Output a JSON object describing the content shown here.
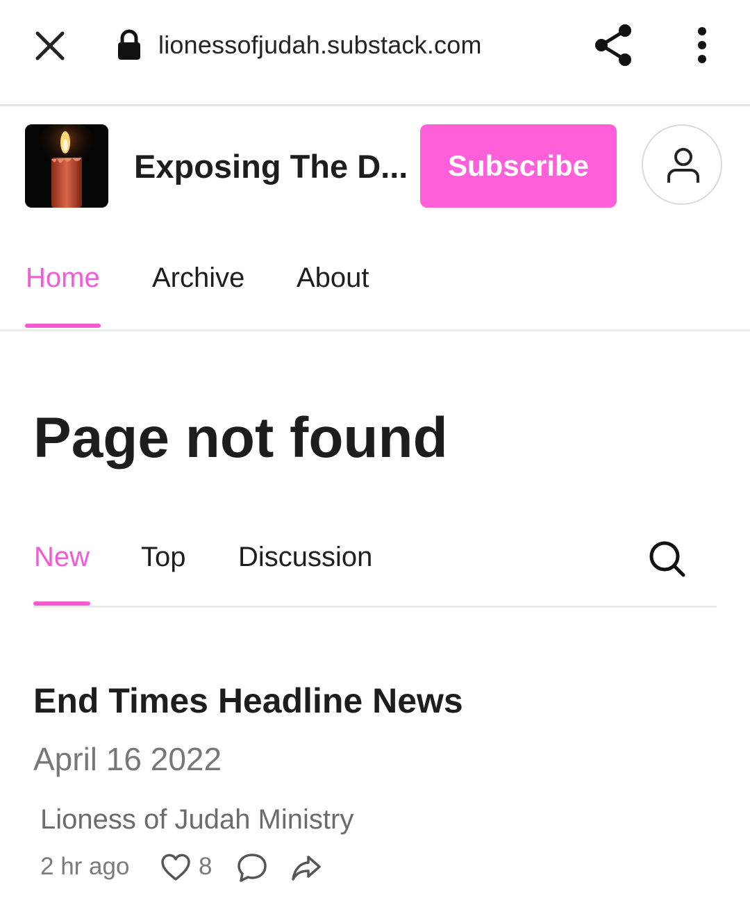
{
  "browser": {
    "url": "lionessofjudah.substack.com",
    "close_icon": "close-icon",
    "lock_icon": "lock-icon",
    "share_icon": "share-icon",
    "menu_icon": "more-vertical-icon"
  },
  "publication": {
    "name": "Exposing The D...",
    "logo": "candle-logo",
    "subscribe_label": "Subscribe",
    "profile_icon": "user-icon"
  },
  "nav": {
    "tabs": [
      {
        "label": "Home",
        "active": true
      },
      {
        "label": "Archive",
        "active": false
      },
      {
        "label": "About",
        "active": false
      }
    ]
  },
  "page": {
    "title": "Page not found"
  },
  "feed": {
    "tabs": [
      {
        "label": "New",
        "active": true
      },
      {
        "label": "Top",
        "active": false
      },
      {
        "label": "Discussion",
        "active": false
      }
    ],
    "search_icon": "search-icon"
  },
  "post": {
    "title": "End Times Headline News",
    "subtitle": "April 16 2022",
    "author": "Lioness of Judah Ministry",
    "time": "2 hr ago",
    "likes": "8"
  },
  "colors": {
    "accent": "#f25ad6",
    "subscribe_bg": "#ff5fd8"
  }
}
